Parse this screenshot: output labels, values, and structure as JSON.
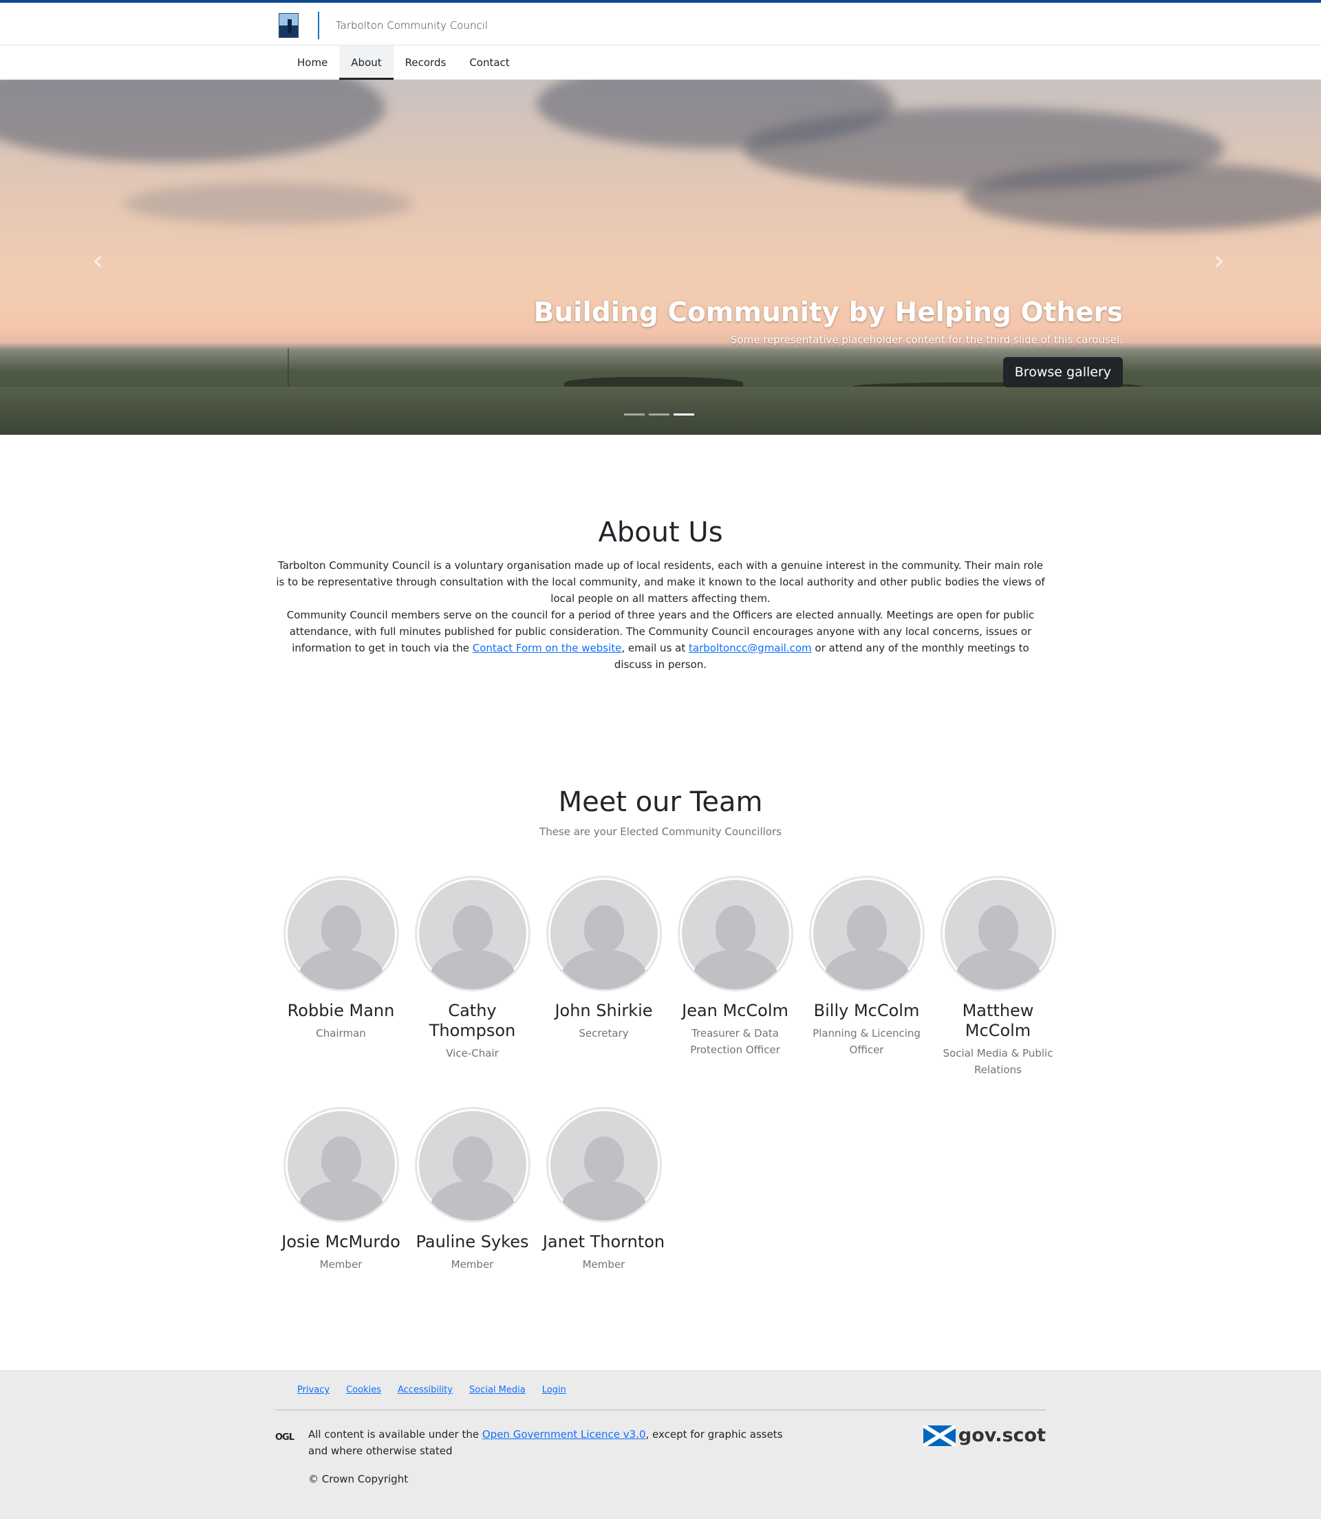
{
  "site": {
    "name": "Tarbolton Community Council",
    "logo_icon": "tarbolton-logo-icon"
  },
  "nav": {
    "items": [
      {
        "label": "Home",
        "active": false
      },
      {
        "label": "About",
        "active": true
      },
      {
        "label": "Records",
        "active": false
      },
      {
        "label": "Contact",
        "active": false
      }
    ]
  },
  "hero": {
    "prev_icon": "‹",
    "next_icon": "›",
    "title": "Building Community by Helping Others",
    "text": "Some representative placeholder content for the third slide of this carousel.",
    "button_label": "Browse gallery",
    "slides_total": 3,
    "slide_active": 3
  },
  "about": {
    "title": "About Us",
    "para1": "Tarbolton Community Council is a voluntary organisation made up of local residents, each with a genuine interest in the community. Their main role is to be representative through consultation with the local community, and make it known to the local authority and other public bodies the views of local people on all matters affecting them.",
    "para2_a": "Community Council members serve on the council for a period of three years and the Officers are elected annually. Meetings are open for public attendance, with full minutes published for public consideration. The Community Council encourages anyone with any local concerns, issues or information to get in touch via the ",
    "contact_link": "Contact Form on the website",
    "para2_b": ", email us at ",
    "email_link": "tarboltoncc@gmail.com",
    "para2_c": " or attend any of the monthly meetings to discuss in person."
  },
  "team": {
    "title": "Meet our Team",
    "subtitle": "These are your Elected Community Councillors",
    "members": [
      {
        "name": "Robbie Mann",
        "role": "Chairman"
      },
      {
        "name": "Cathy Thompson",
        "role": "Vice-Chair"
      },
      {
        "name": "John Shirkie",
        "role": "Secretary"
      },
      {
        "name": "Jean McColm",
        "role": "Treasurer & Data Protection Officer"
      },
      {
        "name": "Billy McColm",
        "role": "Planning & Licencing Officer"
      },
      {
        "name": "Matthew McColm",
        "role": "Social Media & Public Relations"
      },
      {
        "name": "Josie McMurdo",
        "role": "Member"
      },
      {
        "name": "Pauline Sykes",
        "role": "Member"
      },
      {
        "name": "Janet Thornton",
        "role": "Member"
      }
    ]
  },
  "footer": {
    "links": [
      "Privacy",
      "Cookies",
      "Accessibility",
      "Social Media",
      "Login"
    ],
    "ogl_label": "OGL",
    "licence_a": "All content is available under the ",
    "licence_link": "Open Government Licence v3.0",
    "licence_b": ", except for graphic assets and where otherwise stated",
    "copyright": "© Crown Copyright",
    "gov_label": "gov.scot"
  },
  "colors": {
    "accent": "#0b4a8c",
    "link": "#0d6efd",
    "footer_bg": "#ebebeb",
    "button_dark": "#212529"
  }
}
